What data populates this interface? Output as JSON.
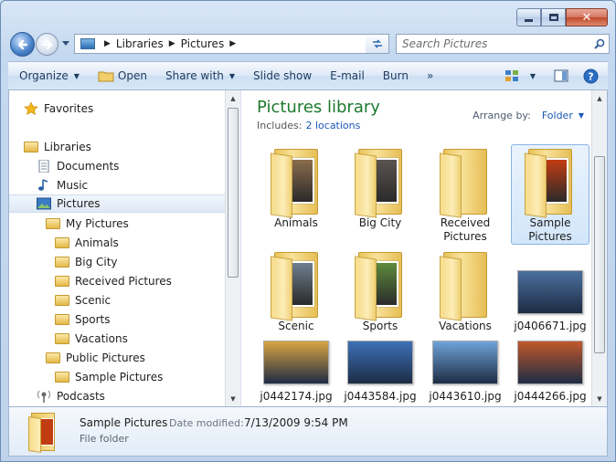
{
  "nav": {
    "address": [
      "Libraries",
      "Pictures"
    ],
    "search_placeholder": "Search Pictures"
  },
  "toolbar": {
    "organize": "Organize",
    "open": "Open",
    "share_with": "Share with",
    "slide_show": "Slide show",
    "email": "E-mail",
    "burn": "Burn",
    "more": "»"
  },
  "tree": {
    "favorites": "Favorites",
    "libraries": "Libraries",
    "documents": "Documents",
    "music": "Music",
    "pictures": "Pictures",
    "my_pictures": "My Pictures",
    "animals": "Animals",
    "big_city": "Big City",
    "received": "Received Pictures",
    "scenic": "Scenic",
    "sports": "Sports",
    "vacations": "Vacations",
    "public_pictures": "Public Pictures",
    "sample_pictures": "Sample Pictures",
    "podcasts": "Podcasts"
  },
  "library": {
    "title": "Pictures library",
    "includes_label": "Includes:",
    "includes_link": "2 locations",
    "arrange_label": "Arrange by:",
    "arrange_value": "Folder"
  },
  "items": [
    {
      "label": "Animals",
      "kind": "folder",
      "photo": "#8a6d4d"
    },
    {
      "label": "Big City",
      "kind": "folder",
      "photo": "#5a5450"
    },
    {
      "label": "Received Pictures",
      "kind": "folder-empty",
      "photo": ""
    },
    {
      "label": "Sample Pictures",
      "kind": "folder",
      "photo": "#c23c12",
      "selected": true
    },
    {
      "label": "Scenic",
      "kind": "folder",
      "photo": "#6f7f8f"
    },
    {
      "label": "Sports",
      "kind": "folder",
      "photo": "#5e8a3d"
    },
    {
      "label": "Vacations",
      "kind": "folder-empty",
      "photo": ""
    },
    {
      "label": "j0406671.jpg",
      "kind": "photo",
      "photo": "#4a6f9c"
    },
    {
      "label": "j0442174.jpg",
      "kind": "photo",
      "photo": "#d9a441"
    },
    {
      "label": "j0443584.jpg",
      "kind": "photo",
      "photo": "#3d71b8"
    },
    {
      "label": "j0443610.jpg",
      "kind": "photo",
      "photo": "#6fa3d9"
    },
    {
      "label": "j0444266.jpg",
      "kind": "photo",
      "photo": "#c0582b"
    }
  ],
  "details": {
    "name": "Sample Pictures",
    "date_label": "Date modified:",
    "date_value": "7/13/2009 9:54 PM",
    "type": "File folder"
  },
  "colors": {
    "library_title": "#1e7a2e",
    "link": "#1c57b4",
    "command_text": "#1e3a5f"
  }
}
